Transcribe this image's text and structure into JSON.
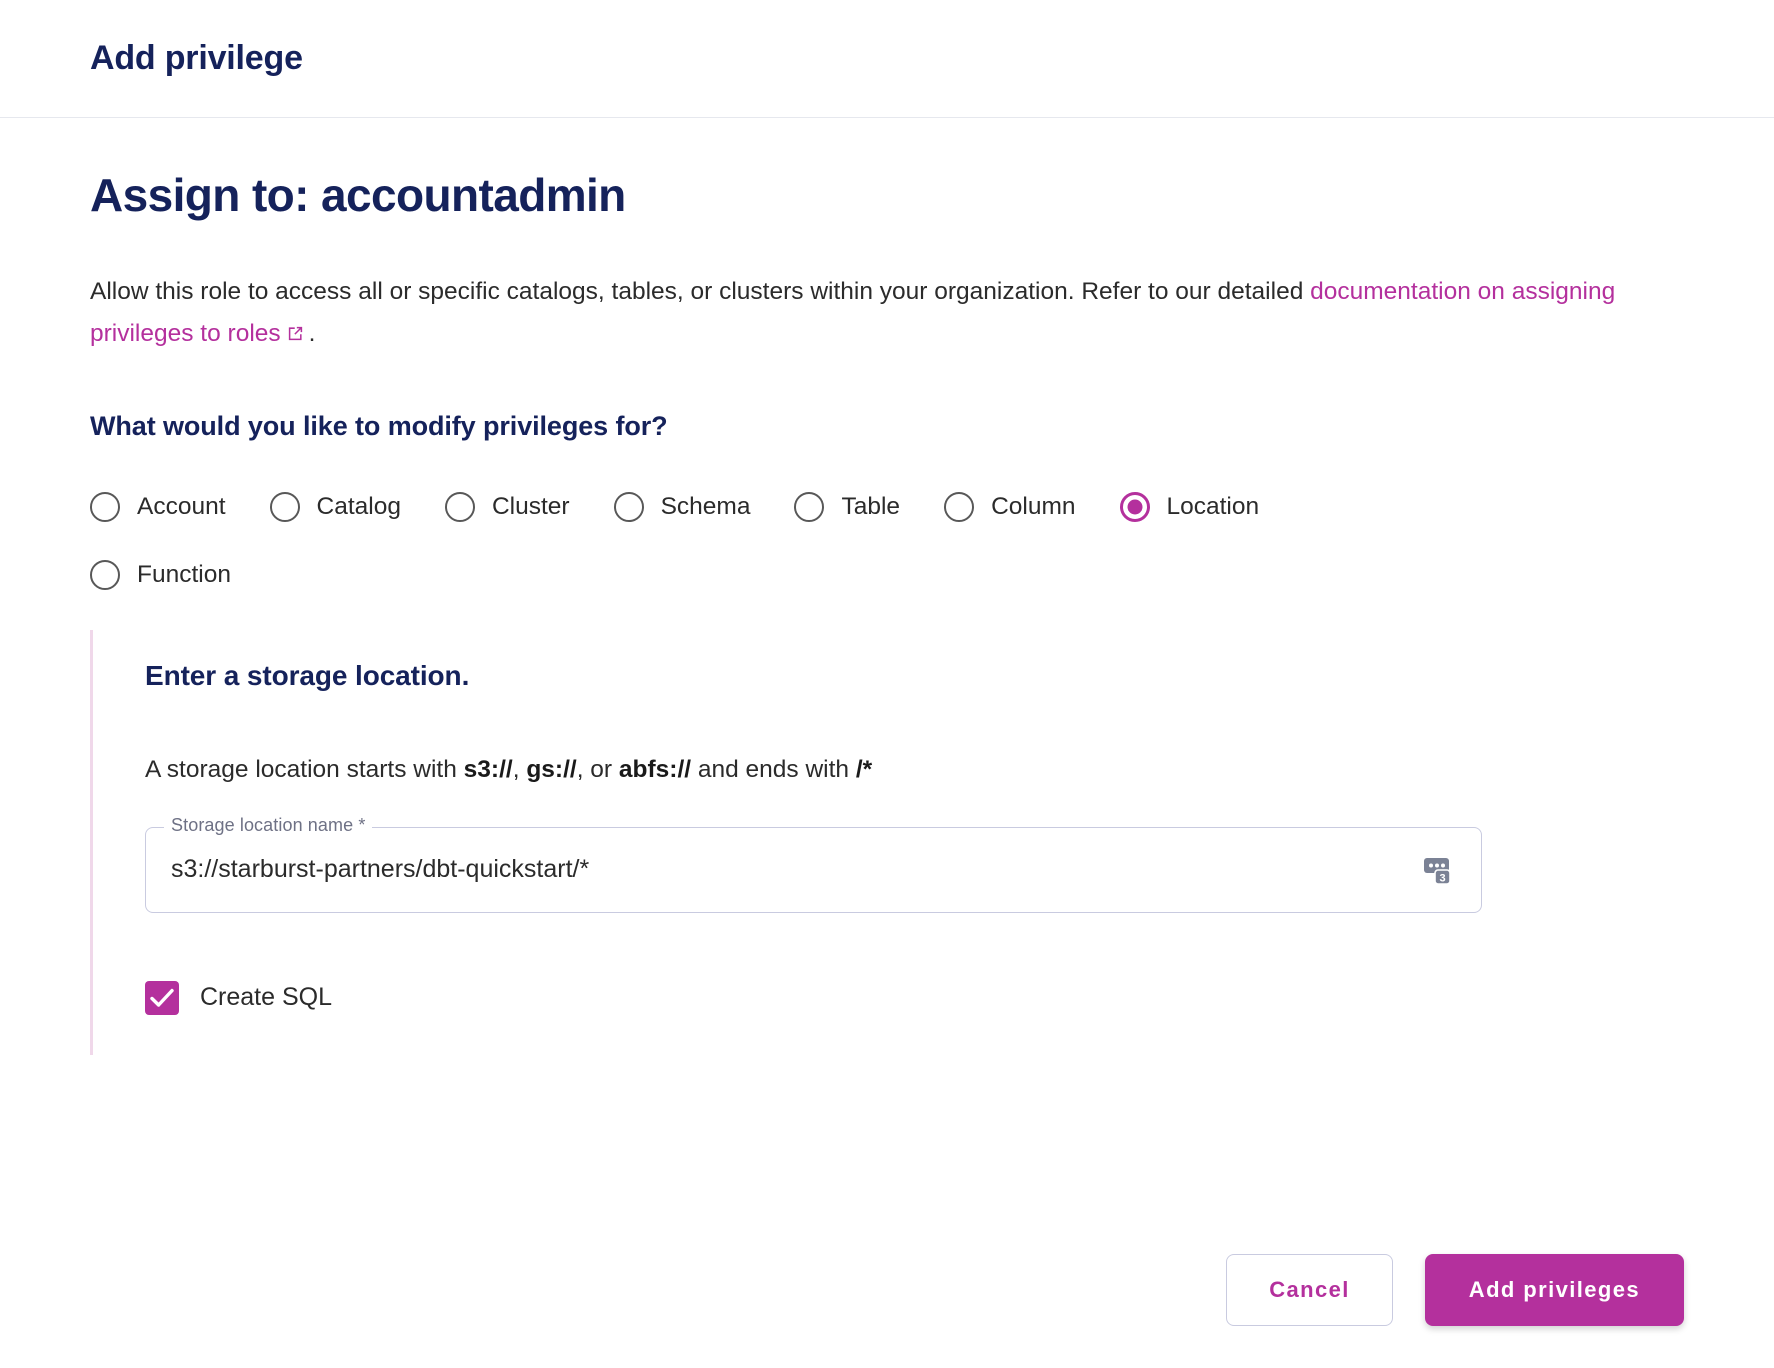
{
  "dialog": {
    "header_title": "Add privilege",
    "assign_title": "Assign to: accountadmin",
    "intro_text_1": "Allow this role to access all or specific catalogs, tables, or clusters within your organization. Refer to our detailed ",
    "intro_link_text": "documentation on assigning privileges to roles",
    "intro_link_icon": "external-link-icon",
    "intro_text_2": ".",
    "question": "What would you like to modify privileges for?"
  },
  "radio_group": {
    "name": "privilege-scope",
    "selected": "Location",
    "options": [
      {
        "label": "Account",
        "selected": false
      },
      {
        "label": "Catalog",
        "selected": false
      },
      {
        "label": "Cluster",
        "selected": false
      },
      {
        "label": "Schema",
        "selected": false
      },
      {
        "label": "Table",
        "selected": false
      },
      {
        "label": "Column",
        "selected": false
      },
      {
        "label": "Location",
        "selected": true
      },
      {
        "label": "Function",
        "selected": false
      }
    ]
  },
  "panel": {
    "heading": "Enter a storage location.",
    "hint_prefix": "A storage location starts with ",
    "hint_p1": "s3://",
    "hint_sep1": ", ",
    "hint_p2": "gs://",
    "hint_sep2": ", or ",
    "hint_p3": "abfs://",
    "hint_middle": " and ends with ",
    "hint_suffix": "/*",
    "field": {
      "label": "Storage location name *",
      "value": "s3://starburst-partners/dbt-quickstart/*",
      "placeholder": "s3://",
      "trailing_icon": "password-manager-badge-icon",
      "trailing_icon_count": "3"
    },
    "checkbox": {
      "label": "Create SQL",
      "checked": true,
      "icon": "checkmark-icon"
    }
  },
  "footer": {
    "cancel_label": "Cancel",
    "submit_label": "Add privileges"
  },
  "colors": {
    "accent": "#b4309d",
    "title": "#15225b",
    "body_text": "#2b2b2b",
    "field_border": "#c9cbe0",
    "panel_rule": "#f0d8ea"
  }
}
